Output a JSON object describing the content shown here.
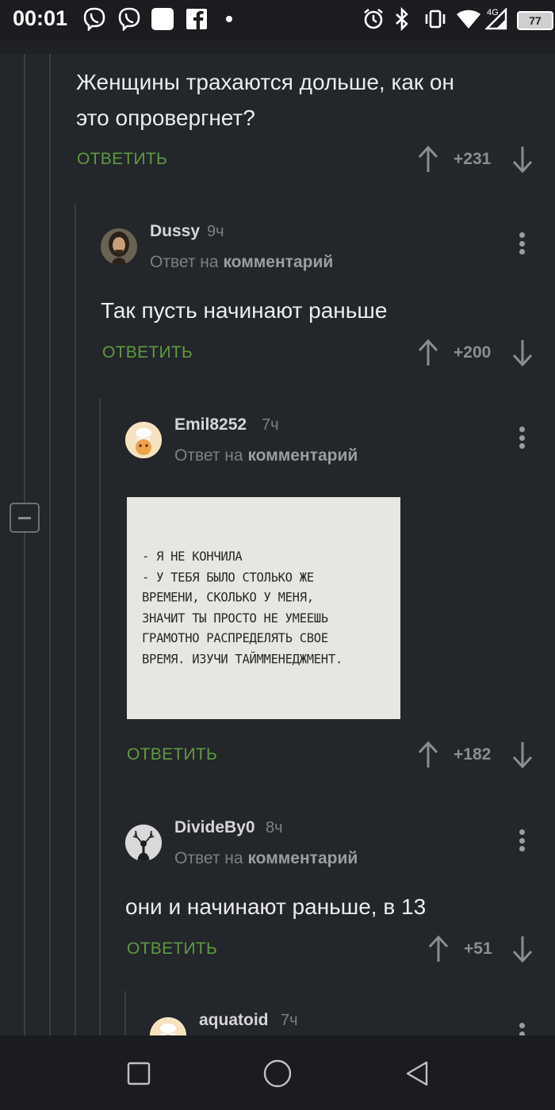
{
  "status_bar": {
    "time": "00:01",
    "network": "4G",
    "battery": "77",
    "icons": [
      "viber-icon",
      "viber-icon",
      "square-notification-icon",
      "facebook-icon",
      "dot-icon",
      "alarm-icon",
      "bluetooth-icon",
      "vibrate-icon",
      "wifi-icon",
      "signal-icon",
      "battery-icon"
    ]
  },
  "comments": [
    {
      "text_lines": [
        "Женщины трахаются дольше, как он",
        "это опровергнет?"
      ],
      "reply_label": "ОТВЕТИТЬ",
      "score": "+231"
    },
    {
      "author": "Dussy",
      "time": "9ч",
      "reply_to_prefix": "Ответ на",
      "reply_to_target": "комментарий",
      "text": "Так пусть начинают раньше",
      "reply_label": "ОТВЕТИТЬ",
      "score": "+200"
    },
    {
      "author": "Emil8252",
      "time": "7ч",
      "reply_to_prefix": "Ответ на",
      "reply_to_target": "комментарий",
      "image_text": "- Я НЕ КОНЧИЛА\n- У ТЕБЯ БЫЛО СТОЛЬКО ЖЕ\nВРЕМЕНИ, СКОЛЬКО У МЕНЯ,\nЗНАЧИТ ТЫ ПРОСТО НЕ УМЕЕШЬ\nГРАМОТНО РАСПРЕДЕЛЯТЬ СВОЕ\nВРЕМЯ. ИЗУЧИ ТАЙММЕНЕДЖМЕНТ.",
      "reply_label": "ОТВЕТИТЬ",
      "score": "+182"
    },
    {
      "author": "DivideBy0",
      "time": "8ч",
      "reply_to_prefix": "Ответ на",
      "reply_to_target": "комментарий",
      "text": "они и начинают раньше, в 13",
      "reply_label": "ОТВЕТИТЬ",
      "score": "+51"
    },
    {
      "author": "aquatoid",
      "time": "7ч"
    }
  ],
  "colors": {
    "background": "#23262a",
    "reply_green": "#5f9a41",
    "muted": "#8a8e93"
  }
}
